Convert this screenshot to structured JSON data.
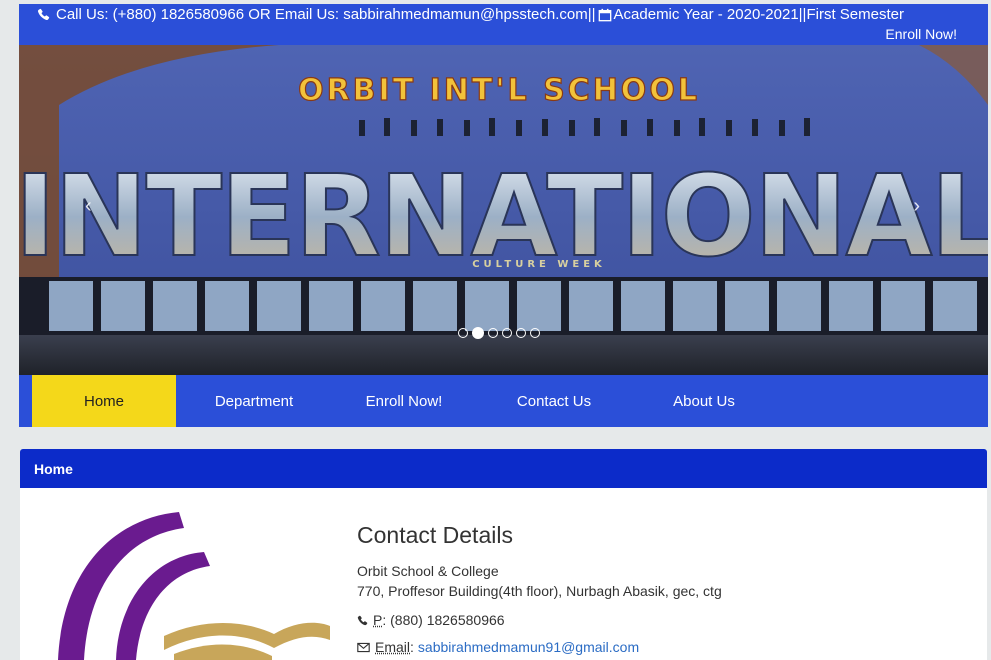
{
  "topbar": {
    "contact_line": "Call Us: (+880) 1826580966 OR Email Us: sabbirahmedmamun@hpsstech.com||",
    "academic_line": "Academic Year - 2020-2021||First Semester",
    "enroll_link": "Enroll Now!",
    "icons": [
      "phone-icon",
      "calendar-icon"
    ]
  },
  "carousel": {
    "banner_top_text": "ORBIT INT'L SCHOOL",
    "banner_main_text": "INTERNATIONAL",
    "banner_sub_text": "CULTURE WEEK",
    "prev_label": "‹",
    "next_label": "›",
    "slide_count": 6,
    "active_slide": 2
  },
  "nav": {
    "items": [
      {
        "label": "Home",
        "active": true
      },
      {
        "label": "Department",
        "active": false
      },
      {
        "label": "Enroll Now!",
        "active": false
      },
      {
        "label": "Contact Us",
        "active": false
      },
      {
        "label": "About Us",
        "active": false
      }
    ]
  },
  "panel": {
    "title": "Home"
  },
  "contact": {
    "heading": "Contact Details",
    "org_name": "Orbit School & College",
    "address": "770, Proffesor Building(4th floor), Nurbagh Abasik, gec, ctg",
    "phone_label": "P",
    "phone_value": ": (880) 1826580966",
    "email_label": "Email",
    "email_sep": ":",
    "email_value": "sabbirahmedmamun91@gmail.com"
  },
  "colors": {
    "bar_blue": "#2b4fd8",
    "panel_blue": "#0c2bc9",
    "active_yellow": "#f4d81a",
    "link_blue": "#2b6cc4",
    "logo_purple": "#6a1b8f",
    "logo_gold": "#c8a65a"
  }
}
